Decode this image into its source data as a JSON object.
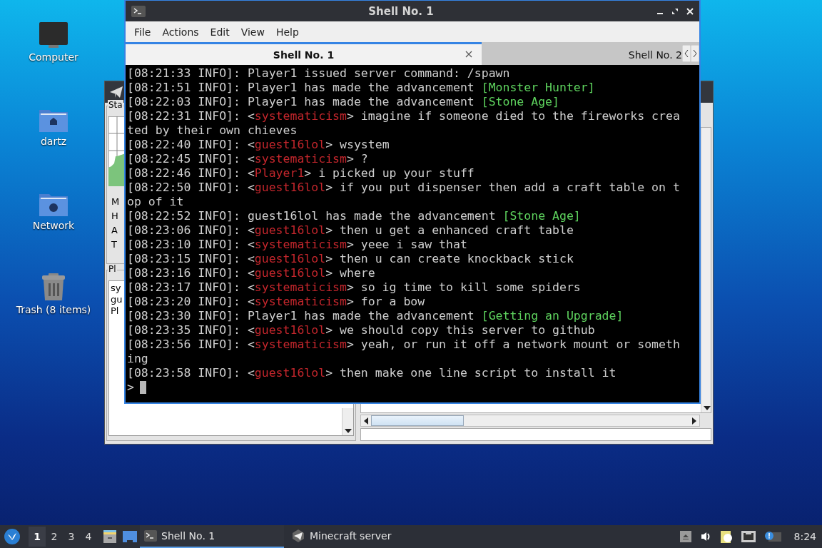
{
  "desktop_icons": [
    {
      "label": "Computer",
      "kind": "computer"
    },
    {
      "label": "dartz",
      "kind": "home"
    },
    {
      "label": "Network",
      "kind": "network"
    },
    {
      "label": "Trash (8 items)",
      "kind": "trash"
    }
  ],
  "server_window": {
    "stats_label": "Sta",
    "stats_rows": [
      "M",
      "H",
      "A",
      "T"
    ],
    "players_label": "Pl",
    "players": [
      "sy",
      "gu",
      "Pl"
    ]
  },
  "shell_window": {
    "title": "Shell No. 1",
    "menu": [
      "File",
      "Actions",
      "Edit",
      "View",
      "Help"
    ],
    "tabs": [
      {
        "label": "Shell No. 1",
        "selected": true
      },
      {
        "label": "Shell No. 2",
        "selected": false
      }
    ],
    "lines": [
      {
        "segments": [
          {
            "text": "[08:21:33 INFO]: Player1 issued server command: /spawn",
            "kind": "plain"
          }
        ]
      },
      {
        "segments": [
          {
            "text": "[08:21:51 INFO]: Player1 has made the advancement ",
            "kind": "plain"
          },
          {
            "text": "[Monster Hunter]",
            "kind": "advancement"
          }
        ]
      },
      {
        "segments": [
          {
            "text": "[08:22:03 INFO]: Player1 has made the advancement ",
            "kind": "plain"
          },
          {
            "text": "[Stone Age]",
            "kind": "advancement"
          }
        ]
      },
      {
        "segments": [
          {
            "text": "[08:22:31 INFO]: <",
            "kind": "plain"
          },
          {
            "text": "systematicism",
            "kind": "player"
          },
          {
            "text": "> imagine if someone died to the fireworks crea",
            "kind": "plain"
          }
        ]
      },
      {
        "segments": [
          {
            "text": "ted by their own chieves",
            "kind": "plain"
          }
        ]
      },
      {
        "segments": [
          {
            "text": "[08:22:40 INFO]: <",
            "kind": "plain"
          },
          {
            "text": "guest16lol",
            "kind": "player"
          },
          {
            "text": "> wsystem",
            "kind": "plain"
          }
        ]
      },
      {
        "segments": [
          {
            "text": "[08:22:45 INFO]: <",
            "kind": "plain"
          },
          {
            "text": "systematicism",
            "kind": "player"
          },
          {
            "text": "> ?",
            "kind": "plain"
          }
        ]
      },
      {
        "segments": [
          {
            "text": "[08:22:46 INFO]: <",
            "kind": "plain"
          },
          {
            "text": "Player1",
            "kind": "player"
          },
          {
            "text": "> i picked up your stuff",
            "kind": "plain"
          }
        ]
      },
      {
        "segments": [
          {
            "text": "[08:22:50 INFO]: <",
            "kind": "plain"
          },
          {
            "text": "guest16lol",
            "kind": "player"
          },
          {
            "text": "> if you put dispenser then add a craft table on t",
            "kind": "plain"
          }
        ]
      },
      {
        "segments": [
          {
            "text": "op of it",
            "kind": "plain"
          }
        ]
      },
      {
        "segments": [
          {
            "text": "[08:22:52 INFO]: guest16lol has made the advancement ",
            "kind": "plain"
          },
          {
            "text": "[Stone Age]",
            "kind": "advancement"
          }
        ]
      },
      {
        "segments": [
          {
            "text": "[08:23:06 INFO]: <",
            "kind": "plain"
          },
          {
            "text": "guest16lol",
            "kind": "player"
          },
          {
            "text": "> then u get a enhanced craft table",
            "kind": "plain"
          }
        ]
      },
      {
        "segments": [
          {
            "text": "[08:23:10 INFO]: <",
            "kind": "plain"
          },
          {
            "text": "systematicism",
            "kind": "player"
          },
          {
            "text": "> yeee i saw that",
            "kind": "plain"
          }
        ]
      },
      {
        "segments": [
          {
            "text": "[08:23:15 INFO]: <",
            "kind": "plain"
          },
          {
            "text": "guest16lol",
            "kind": "player"
          },
          {
            "text": "> then u can create knockback stick",
            "kind": "plain"
          }
        ]
      },
      {
        "segments": [
          {
            "text": "[08:23:16 INFO]: <",
            "kind": "plain"
          },
          {
            "text": "guest16lol",
            "kind": "player"
          },
          {
            "text": "> where",
            "kind": "plain"
          }
        ]
      },
      {
        "segments": [
          {
            "text": "[08:23:17 INFO]: <",
            "kind": "plain"
          },
          {
            "text": "systematicism",
            "kind": "player"
          },
          {
            "text": "> so ig time to kill some spiders",
            "kind": "plain"
          }
        ]
      },
      {
        "segments": [
          {
            "text": "[08:23:20 INFO]: <",
            "kind": "plain"
          },
          {
            "text": "systematicism",
            "kind": "player"
          },
          {
            "text": "> for a bow",
            "kind": "plain"
          }
        ]
      },
      {
        "segments": [
          {
            "text": "[08:23:30 INFO]: Player1 has made the advancement ",
            "kind": "plain"
          },
          {
            "text": "[Getting an Upgrade]",
            "kind": "advancement"
          }
        ]
      },
      {
        "segments": [
          {
            "text": "[08:23:35 INFO]: <",
            "kind": "plain"
          },
          {
            "text": "guest16lol",
            "kind": "player"
          },
          {
            "text": "> we should copy this server to github",
            "kind": "plain"
          }
        ]
      },
      {
        "segments": [
          {
            "text": "[08:23:56 INFO]: <",
            "kind": "plain"
          },
          {
            "text": "systematicism",
            "kind": "player"
          },
          {
            "text": "> yeah, or run it off a network mount or someth",
            "kind": "plain"
          }
        ]
      },
      {
        "segments": [
          {
            "text": "ing",
            "kind": "plain"
          }
        ]
      },
      {
        "segments": [
          {
            "text": "[08:23:58 INFO]: <",
            "kind": "plain"
          },
          {
            "text": "guest16lol",
            "kind": "player"
          },
          {
            "text": "> then make one line script to install it",
            "kind": "plain"
          }
        ]
      }
    ],
    "prompt": ">"
  },
  "taskbar": {
    "workspaces": [
      {
        "label": "1",
        "selected": true
      },
      {
        "label": "2",
        "selected": false
      },
      {
        "label": "3",
        "selected": false
      },
      {
        "label": "4",
        "selected": false
      }
    ],
    "tasks": [
      {
        "label": "Shell No. 1",
        "kind": "terminal",
        "selected": true
      },
      {
        "label": "Minecraft server",
        "kind": "server",
        "selected": false
      }
    ],
    "clock": "8:24"
  }
}
